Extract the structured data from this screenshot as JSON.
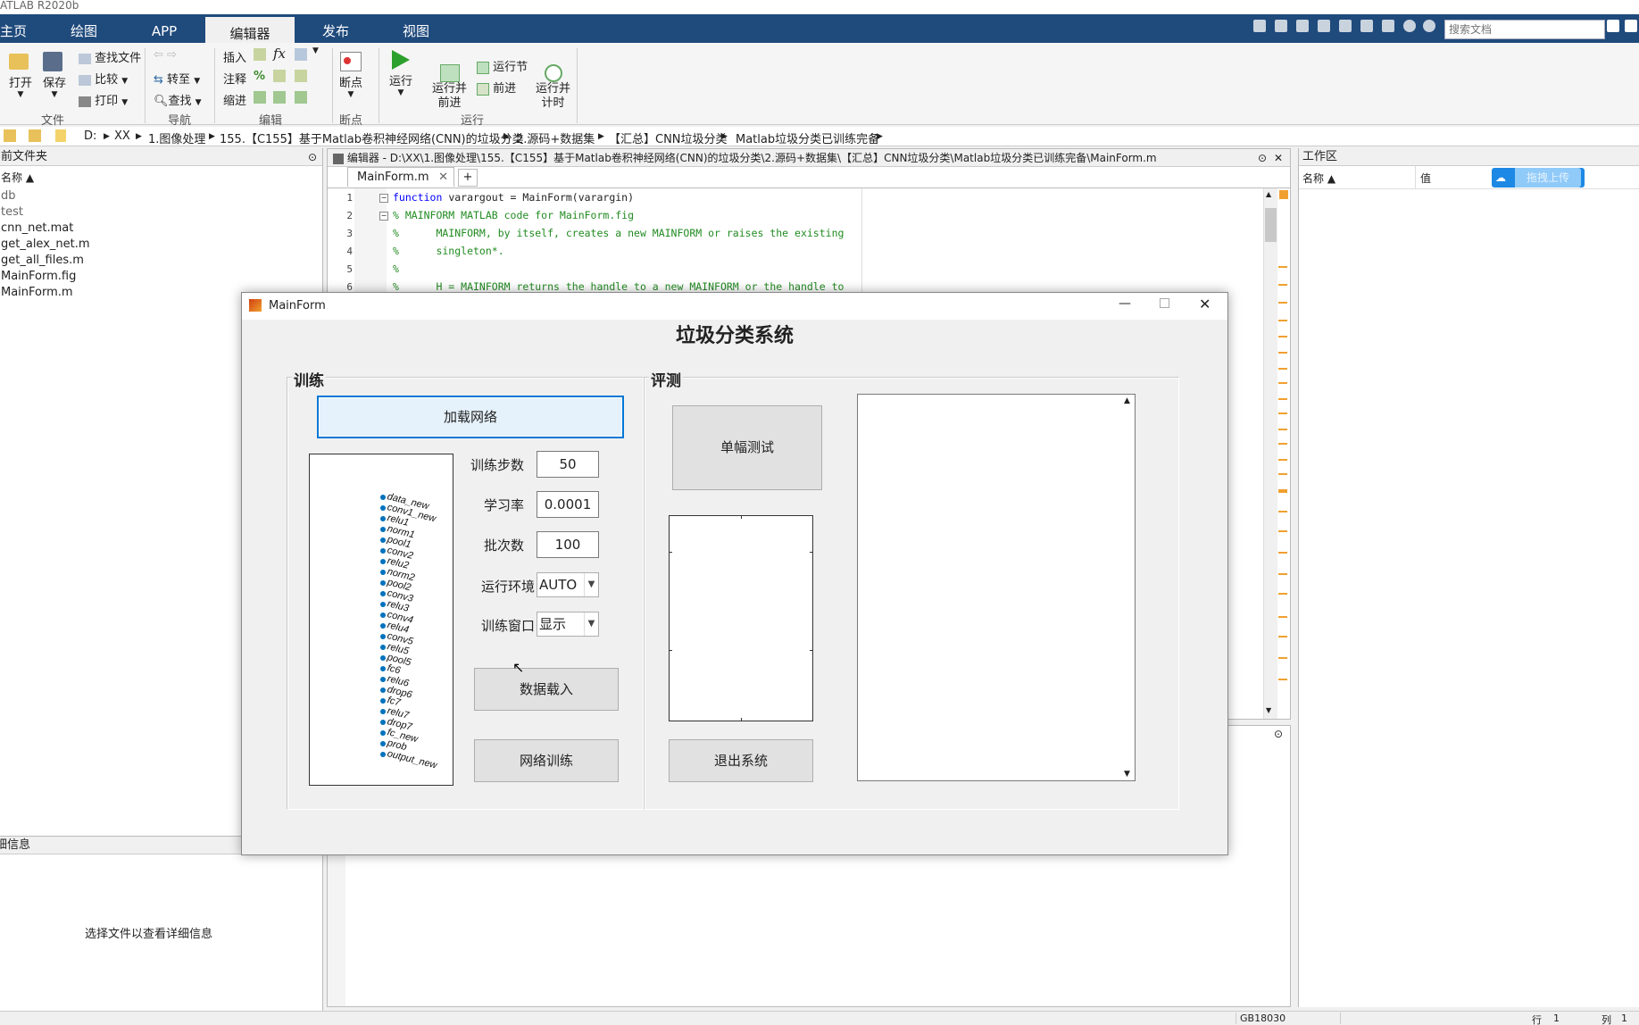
{
  "app": {
    "title": "ATLAB R2020b"
  },
  "ribbon_tabs": [
    {
      "label": "主页"
    },
    {
      "label": "绘图"
    },
    {
      "label": "APP"
    },
    {
      "label": "编辑器"
    },
    {
      "label": "发布"
    },
    {
      "label": "视图"
    }
  ],
  "search": {
    "placeholder": "搜索文档"
  },
  "ribbon": {
    "file": {
      "open": "打开",
      "save": "保存",
      "find_files": "查找文件",
      "compare": "比较",
      "print": "打印",
      "group": "文件"
    },
    "nav": {
      "goto": "转至",
      "find": "查找",
      "group": "导航"
    },
    "edit": {
      "insert": "插入",
      "comment": "注释",
      "indent": "缩进",
      "fx": "fx",
      "percent": "%",
      "group": "编辑"
    },
    "breakpoints": {
      "label": "断点",
      "group": "断点"
    },
    "run": {
      "run": "运行",
      "run_advance": "运行并\n前进",
      "run_section": "运行节",
      "advance": "前进",
      "run_time": "运行并\n计时",
      "group": "运行"
    }
  },
  "breadcrumbs": [
    "D:",
    "XX",
    "1.图像处理",
    "155.【C155】基于Matlab卷积神经网络(CNN)的垃圾分类",
    "2.源码+数据集",
    "【汇总】CNN垃圾分类",
    "Matlab垃圾分类已训练完备"
  ],
  "current_folder": {
    "header": "当前文件夹",
    "col_name": "名称 ▲",
    "files": [
      "db",
      "test",
      "cnn_net.mat",
      "get_alex_net.m",
      "get_all_files.m",
      "MainForm.fig",
      "MainForm.m"
    ]
  },
  "details": {
    "header": "详细信息",
    "hint": "选择文件以查看详细信息"
  },
  "editor": {
    "title": "编辑器 - D:\\XX\\1.图像处理\\155.【C155】基于Matlab卷积神经网络(CNN)的垃圾分类\\2.源码+数据集\\【汇总】CNN垃圾分类\\Matlab垃圾分类已训练完备\\MainForm.m",
    "tab": "MainForm.m",
    "lines": [
      {
        "n": "1",
        "kw": "function",
        "text": " varargout = MainForm(varargin)",
        "cls": ""
      },
      {
        "n": "2",
        "kw": "",
        "text": "% MAINFORM MATLAB code for MainForm.fig",
        "cls": "cm"
      },
      {
        "n": "3",
        "kw": "",
        "text": "%      MAINFORM, by itself, creates a new MAINFORM or raises the existing",
        "cls": "cm"
      },
      {
        "n": "4",
        "kw": "",
        "text": "%      singleton*.",
        "cls": "cm"
      },
      {
        "n": "5",
        "kw": "",
        "text": "%",
        "cls": "cm"
      },
      {
        "n": "6",
        "kw": "",
        "text": "%      H = MAINFORM returns the handle to a new MAINFORM or the handle to",
        "cls": "cm"
      }
    ]
  },
  "workspace": {
    "header": "工作区",
    "col_name": "名称 ▲",
    "col_value": "值",
    "upload": "拖拽上传"
  },
  "status": {
    "encoding": "GB18030",
    "row_label": "行",
    "row": "1",
    "col_label": "列",
    "col": "1"
  },
  "dialog": {
    "title": "MainForm",
    "heading": "垃圾分类系统",
    "train_panel": "训练",
    "eval_panel": "评测",
    "load_net": "加载网络",
    "epochs_label": "训练步数",
    "epochs": "50",
    "lr_label": "学习率",
    "lr": "0.0001",
    "batch_label": "批次数",
    "batch": "100",
    "env_label": "运行环境",
    "env": "AUTO",
    "window_label": "训练窗口",
    "window": "显示",
    "load_data": "数据载入",
    "train": "网络训练",
    "single_test": "单幅测试",
    "exit": "退出系统",
    "layers": [
      "data_new",
      "conv1_new",
      "relu1",
      "norm1",
      "pool1",
      "conv2",
      "relu2",
      "norm2",
      "pool2",
      "conv3",
      "relu3",
      "conv4",
      "relu4",
      "conv5",
      "relu5",
      "pool5",
      "fc6",
      "relu6",
      "drop6",
      "fc7",
      "relu7",
      "drop7",
      "fc_new",
      "prob",
      "output_new"
    ]
  }
}
